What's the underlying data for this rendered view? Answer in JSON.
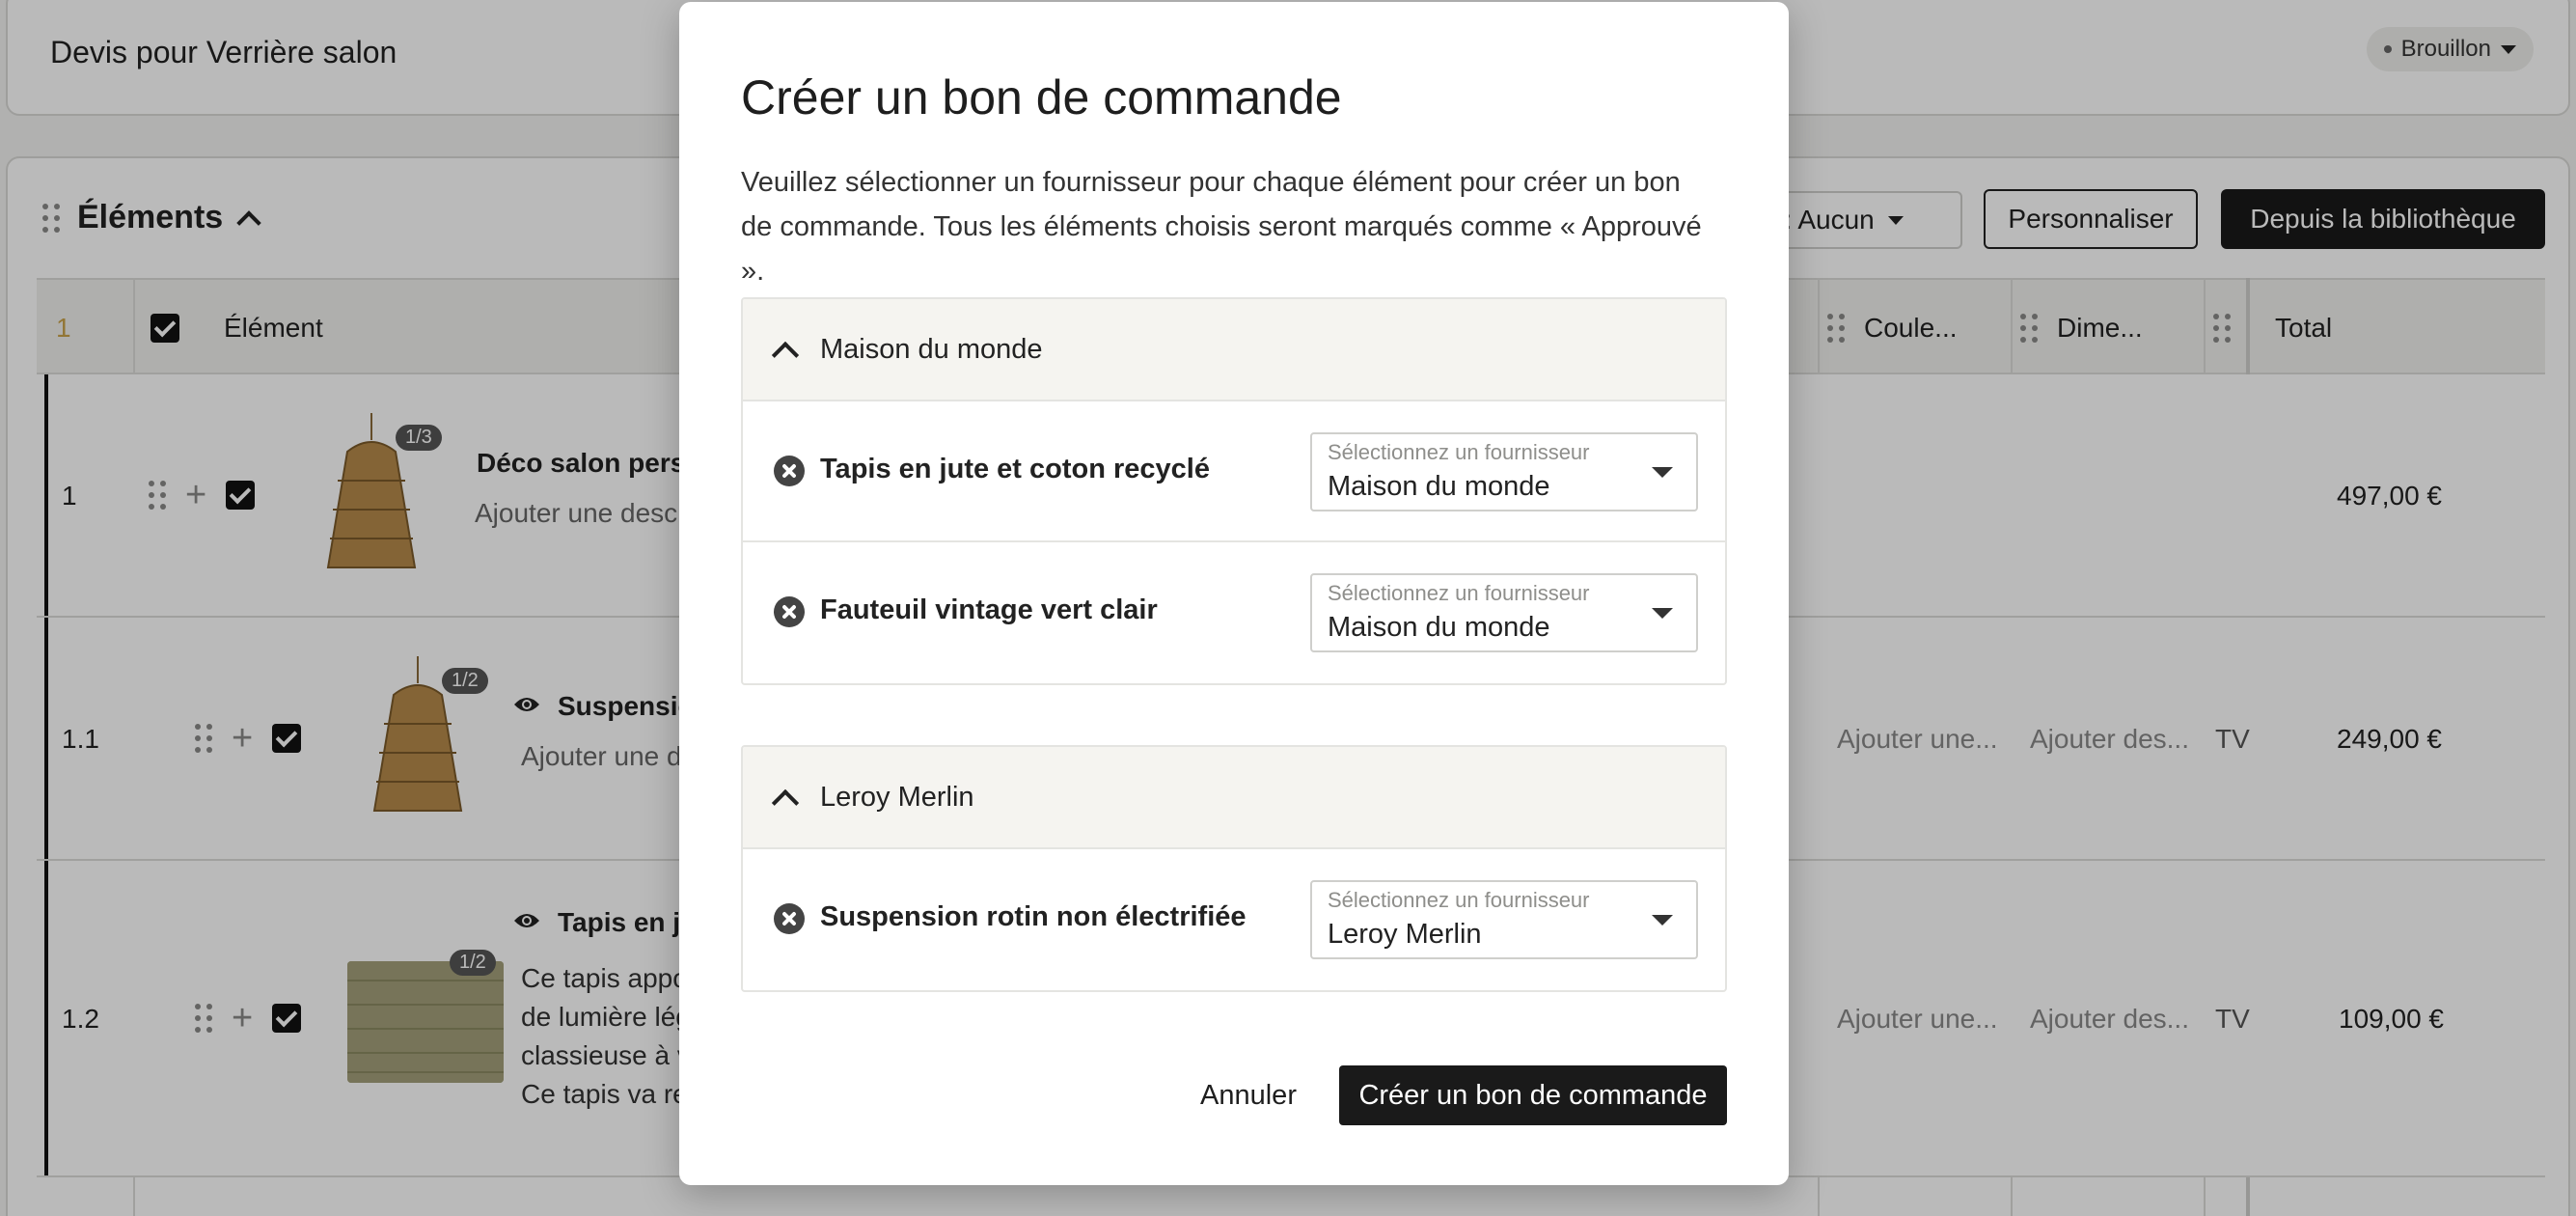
{
  "header": {
    "title": "Devis pour Verrière salon",
    "status": "Brouillon"
  },
  "toolbar": {
    "section_title": "Éléments",
    "filter_label": "r: Aucun",
    "customize": "Personnaliser",
    "library": "Depuis la bibliothèque"
  },
  "table": {
    "header_index": "1",
    "columns": {
      "element": "Élément",
      "color": "Coule...",
      "dimensions": "Dime...",
      "total": "Total"
    },
    "rows": [
      {
        "num": "1",
        "badge": "1/3",
        "title": "Déco salon perso",
        "desc": "Ajouter une desc",
        "color": "",
        "dims": "",
        "extra": "",
        "total": "497,00 €"
      },
      {
        "num": "1.1",
        "badge": "1/2",
        "title": "Suspensio",
        "desc": "Ajouter une d",
        "color": "Ajouter une...",
        "dims": "Ajouter des...",
        "extra": "TV",
        "total": "249,00 €"
      },
      {
        "num": "1.2",
        "badge": "1/2",
        "title": "Tapis en ju",
        "desc_lines": [
          "Ce tapis appo",
          "de lumière lég",
          "classieuse à v",
          "Ce tapis va re"
        ],
        "color": "Ajouter une...",
        "dims": "Ajouter des...",
        "extra": "TV",
        "total": "109,00 €"
      }
    ]
  },
  "modal": {
    "title": "Créer un bon de commande",
    "description": "Veuillez sélectionner un fournisseur pour chaque élément pour créer un bon de commande. Tous les éléments choisis seront marqués comme « Approuvé ».",
    "select_label": "Sélectionnez un fournisseur",
    "groups": [
      {
        "name": "Maison du monde",
        "items": [
          {
            "label": "Tapis en jute et coton recyclé",
            "supplier": "Maison du monde"
          },
          {
            "label": "Fauteuil vintage vert clair",
            "supplier": "Maison du monde"
          }
        ]
      },
      {
        "name": "Leroy Merlin",
        "items": [
          {
            "label": "Suspension rotin non électrifiée",
            "supplier": "Leroy Merlin"
          }
        ]
      }
    ],
    "cancel": "Annuler",
    "submit": "Créer un bon de commande"
  }
}
